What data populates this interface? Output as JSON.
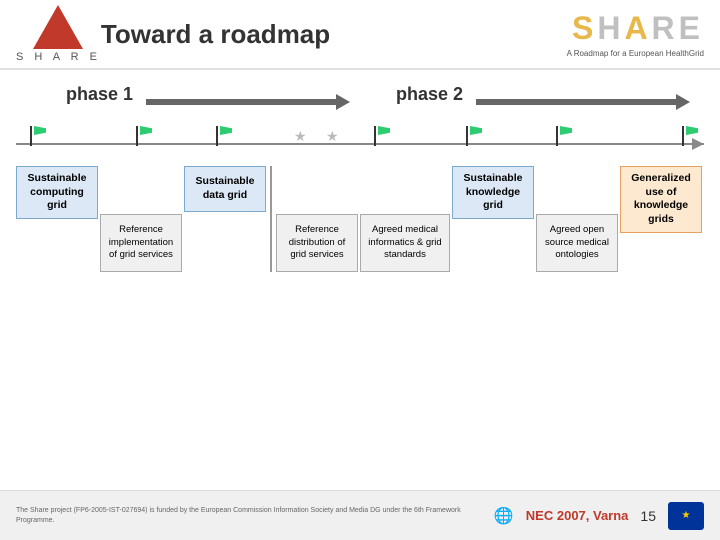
{
  "header": {
    "title": "Toward a roadmap",
    "share_logo": "SHARE",
    "share_tagline": "A Roadmap for a European HealthGrid"
  },
  "phases": {
    "phase1": "phase 1",
    "phase2": "phase 2"
  },
  "columns": [
    {
      "id": "sustainable-computing",
      "top_label": "Sustainable computing grid",
      "sub_label": "",
      "top_style": "blue",
      "sub_style": "none"
    },
    {
      "id": "reference-impl",
      "top_label": "",
      "sub_label": "Reference implementation of grid services",
      "top_style": "none",
      "sub_style": "light"
    },
    {
      "id": "sustainable-data",
      "top_label": "Sustainable data grid",
      "sub_label": "",
      "top_style": "blue",
      "sub_style": "none"
    },
    {
      "id": "reference-dist",
      "top_label": "",
      "sub_label": "Reference distribution of grid services",
      "top_style": "none",
      "sub_style": "light"
    },
    {
      "id": "agreed-medical",
      "top_label": "",
      "sub_label": "Agreed medical informatics & grid standards",
      "top_style": "none",
      "sub_style": "light"
    },
    {
      "id": "sustainable-knowledge",
      "top_label": "Sustainable knowledge grid",
      "sub_label": "",
      "top_style": "blue",
      "sub_style": "none"
    },
    {
      "id": "agreed-open",
      "top_label": "",
      "sub_label": "Agreed open source medical ontologies",
      "top_style": "none",
      "sub_style": "light"
    },
    {
      "id": "generalized",
      "top_label": "Generalized use of knowledge grids",
      "sub_label": "",
      "top_style": "orange",
      "sub_style": "none"
    }
  ],
  "footer": {
    "description": "The Share project (FP6-2005-IST-027694) is funded by the European Commission Information Society and Media DG under the 6th Framework Programme.",
    "conference": "NEC 2007, Varna",
    "page_number": "15"
  },
  "flags": {
    "green_positions": [
      1,
      2,
      3,
      5,
      6,
      7
    ],
    "grey_positions": [
      4
    ]
  }
}
